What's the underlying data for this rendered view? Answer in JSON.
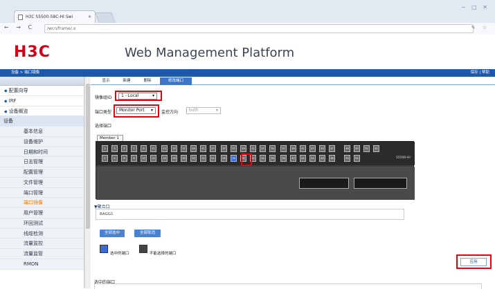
{
  "browser": {
    "tab_title": "H3C S5500-58C-HI Swi",
    "tab_close": "×",
    "url": "/wcn/frame/.x",
    "win_controls": "− □ ✕",
    "nav_glyphs": "← → C",
    "right_glyphs": "✎ ☆"
  },
  "header": {
    "logo": "H3C",
    "title": "Web Management Platform"
  },
  "bluebar": {
    "breadcrumb": "设备 > 端口镜像",
    "right": "保存 | 帮助"
  },
  "sidebar": {
    "top": [
      {
        "label": "配置向导"
      },
      {
        "label": "IRF"
      },
      {
        "label": "设备概览"
      }
    ],
    "category": "设备",
    "items": [
      {
        "label": "基本信息"
      },
      {
        "label": "设备维护"
      },
      {
        "label": "日期和时间"
      },
      {
        "label": "日志管理"
      },
      {
        "label": "配置管理"
      },
      {
        "label": "文件管理"
      },
      {
        "label": "端口管理"
      },
      {
        "label": "端口镜像",
        "selected": true
      },
      {
        "label": "用户管理"
      },
      {
        "label": "环回测试"
      },
      {
        "label": "线缆检测"
      },
      {
        "label": "流量监控"
      },
      {
        "label": "流量监管"
      },
      {
        "label": "RMON"
      }
    ]
  },
  "tabs": [
    {
      "label": "显示"
    },
    {
      "label": "新建"
    },
    {
      "label": "删除"
    },
    {
      "label": "修改端口",
      "active": true
    }
  ],
  "form": {
    "mirror_group_label": "镜像组ID",
    "mirror_group_value": "1 - Local",
    "port_type_label": "端口类型",
    "port_type_value": "Monitor Port",
    "direction_label": "监控方向",
    "direction_value": "both",
    "select_port_label": "选择端口",
    "member_tab": "Member 1"
  },
  "panel": {
    "device": "S5500-HI",
    "ports_top": [
      "1",
      "3",
      "5",
      "7",
      "9",
      "11",
      "13",
      "15",
      "17",
      "19",
      "21",
      "23",
      "25",
      "27",
      "29",
      "31",
      "33",
      "35",
      "37",
      "39",
      "41",
      "43",
      "45",
      "47",
      "49",
      "50",
      "51",
      "52"
    ],
    "ports_bottom": [
      "2",
      "4",
      "6",
      "8",
      "10",
      "12",
      "14",
      "16",
      "18",
      "20",
      "22",
      "24",
      "26",
      "28",
      "30",
      "32",
      "34",
      "36",
      "38",
      "40",
      "42",
      "44",
      "46",
      "48",
      "53",
      "54"
    ],
    "selected_port": "28"
  },
  "aggregation": {
    "label": "▼聚合口",
    "value": "BAGG1"
  },
  "buttons": {
    "select_all": "全部选中",
    "deselect_all": "全部取消",
    "apply": "应用"
  },
  "legend": {
    "selected": "选中的端口",
    "unselectable": "不能选择的端口",
    "selected_color": "#3d6bd6",
    "unselectable_color": "#444444"
  },
  "selected_ports": {
    "label": "选中的端口"
  }
}
